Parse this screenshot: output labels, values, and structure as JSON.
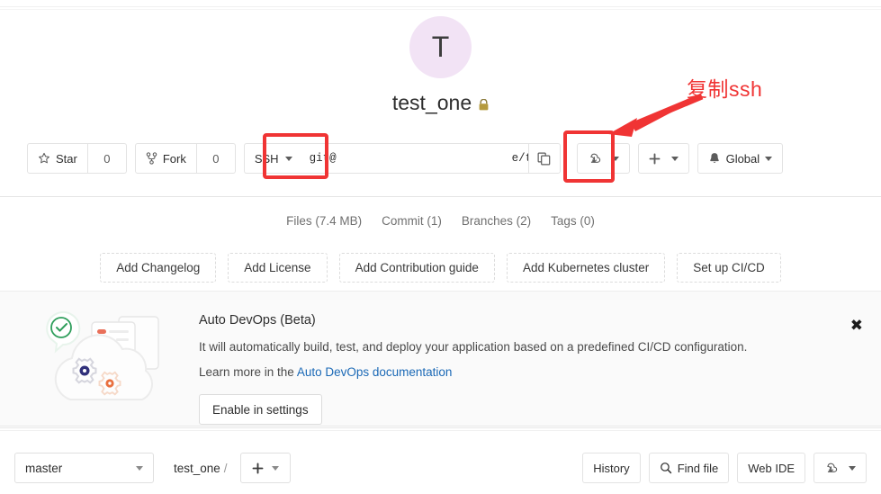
{
  "project": {
    "avatar_letter": "T",
    "name": "test_one",
    "visibility_icon": "lock-icon"
  },
  "actions": {
    "star_label": "Star",
    "star_count": "0",
    "star_icon": "star-icon",
    "fork_label": "Fork",
    "fork_count": "0",
    "fork_icon": "fork-icon",
    "clone_protocol": "SSH",
    "clone_url_prefix": "git@",
    "clone_url_redacted": "                          ",
    "clone_url_suffix": "e/test_o",
    "copy_icon": "copy-icon",
    "download_icon": "download-icon",
    "plus_icon": "plus-icon",
    "notification_icon": "bell-icon",
    "notification_label": "Global"
  },
  "annotation": {
    "text": "复制ssh",
    "color": "#f03434"
  },
  "stats": [
    "Files (7.4 MB)",
    "Commit (1)",
    "Branches (2)",
    "Tags (0)"
  ],
  "quick_actions": [
    "Add Changelog",
    "Add License",
    "Add Contribution guide",
    "Add Kubernetes cluster",
    "Set up CI/CD"
  ],
  "devops": {
    "title": "Auto DevOps (Beta)",
    "description": "It will automatically build, test, and deploy your application based on a predefined CI/CD configuration.",
    "learn_prefix": "Learn more in the ",
    "learn_link": "Auto DevOps documentation",
    "enable_button": "Enable in settings",
    "close_icon": "close-icon",
    "close_glyph": "✖"
  },
  "bottom_bar": {
    "branch": "master",
    "breadcrumb_root": "test_one",
    "breadcrumb_sep": "/",
    "add_icon": "plus-icon",
    "history_label": "History",
    "find_file_label": "Find file",
    "find_file_icon": "search-icon",
    "web_ide_label": "Web IDE",
    "download_icon": "download-icon"
  },
  "colors": {
    "accent_red": "#f03434",
    "link_blue": "#1b69b6",
    "avatar_bg": "#f2e3f5",
    "panel_bg": "#fafafa"
  }
}
